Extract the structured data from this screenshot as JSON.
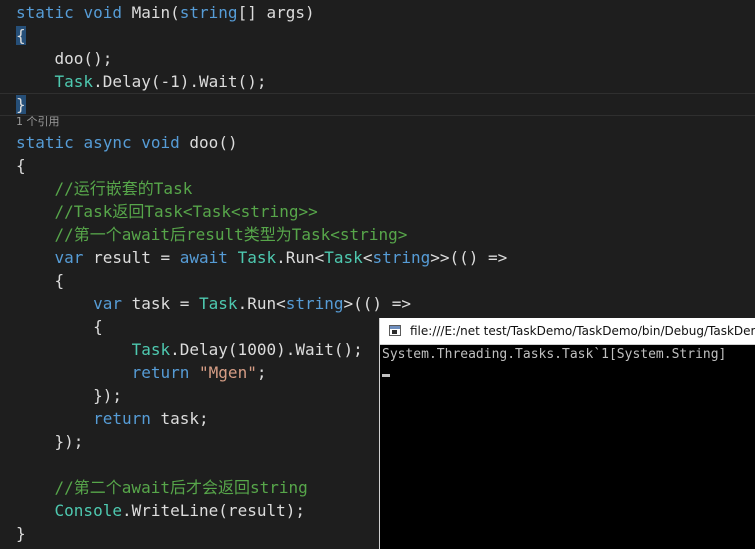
{
  "colors": {
    "editor_bg": "#1e1e1e",
    "keyword": "#569cd6",
    "type": "#4ec9b0",
    "comment": "#57a64a",
    "string": "#d69d85",
    "text": "#dcdcdc",
    "console_bg": "#000000"
  },
  "editor": {
    "codelens": "1 个引用",
    "lines": [
      [
        {
          "c": "kw",
          "t": "static"
        },
        {
          "c": "tx",
          "t": " "
        },
        {
          "c": "kw",
          "t": "void"
        },
        {
          "c": "tx",
          "t": " Main("
        },
        {
          "c": "kw",
          "t": "string"
        },
        {
          "c": "tx",
          "t": "[] args)"
        }
      ],
      [
        {
          "c": "tx br-hl",
          "t": "{"
        }
      ],
      [
        {
          "c": "tx",
          "t": "    doo();"
        }
      ],
      [
        {
          "c": "tx",
          "t": "    "
        },
        {
          "c": "ty",
          "t": "Task"
        },
        {
          "c": "tx",
          "t": ".Delay(-1).Wait();"
        }
      ],
      [
        {
          "c": "tx br-hl",
          "t": "}"
        }
      ],
      [
        {
          "c": "kw",
          "t": "static"
        },
        {
          "c": "tx",
          "t": " "
        },
        {
          "c": "kw",
          "t": "async"
        },
        {
          "c": "tx",
          "t": " "
        },
        {
          "c": "kw",
          "t": "void"
        },
        {
          "c": "tx",
          "t": " doo()"
        }
      ],
      [
        {
          "c": "tx",
          "t": "{"
        }
      ],
      [
        {
          "c": "tx",
          "t": "    "
        },
        {
          "c": "cm",
          "t": "//运行嵌套的Task"
        }
      ],
      [
        {
          "c": "tx",
          "t": "    "
        },
        {
          "c": "cm",
          "t": "//Task返回Task<Task<string>>"
        }
      ],
      [
        {
          "c": "tx",
          "t": "    "
        },
        {
          "c": "cm",
          "t": "//第一个await后result类型为Task<string>"
        }
      ],
      [
        {
          "c": "tx",
          "t": "    "
        },
        {
          "c": "kw",
          "t": "var"
        },
        {
          "c": "tx",
          "t": " result = "
        },
        {
          "c": "kw",
          "t": "await"
        },
        {
          "c": "tx",
          "t": " "
        },
        {
          "c": "ty",
          "t": "Task"
        },
        {
          "c": "tx",
          "t": ".Run<"
        },
        {
          "c": "ty",
          "t": "Task"
        },
        {
          "c": "tx",
          "t": "<"
        },
        {
          "c": "kw",
          "t": "string"
        },
        {
          "c": "tx",
          "t": ">>(() =>"
        }
      ],
      [
        {
          "c": "tx",
          "t": "    {"
        }
      ],
      [
        {
          "c": "tx",
          "t": "        "
        },
        {
          "c": "kw",
          "t": "var"
        },
        {
          "c": "tx",
          "t": " task = "
        },
        {
          "c": "ty",
          "t": "Task"
        },
        {
          "c": "tx",
          "t": ".Run<"
        },
        {
          "c": "kw",
          "t": "string"
        },
        {
          "c": "tx",
          "t": ">(() =>"
        }
      ],
      [
        {
          "c": "tx",
          "t": "        {"
        }
      ],
      [
        {
          "c": "tx",
          "t": "            "
        },
        {
          "c": "ty",
          "t": "Task"
        },
        {
          "c": "tx",
          "t": ".Delay(1000).Wait();"
        }
      ],
      [
        {
          "c": "tx",
          "t": "            "
        },
        {
          "c": "kw",
          "t": "return"
        },
        {
          "c": "tx",
          "t": " "
        },
        {
          "c": "st",
          "t": "\"Mgen\""
        },
        {
          "c": "tx",
          "t": ";"
        }
      ],
      [
        {
          "c": "tx",
          "t": "        });"
        }
      ],
      [
        {
          "c": "tx",
          "t": "        "
        },
        {
          "c": "kw",
          "t": "return"
        },
        {
          "c": "tx",
          "t": " task;"
        }
      ],
      [
        {
          "c": "tx",
          "t": "    });"
        }
      ],
      [
        {
          "c": "tx",
          "t": ""
        }
      ],
      [
        {
          "c": "tx",
          "t": "    "
        },
        {
          "c": "cm",
          "t": "//第二个await后才会返回string"
        }
      ],
      [
        {
          "c": "tx",
          "t": "    "
        },
        {
          "c": "ty",
          "t": "Console"
        },
        {
          "c": "tx",
          "t": ".WriteLine(result);"
        }
      ],
      [
        {
          "c": "tx",
          "t": "}"
        }
      ]
    ]
  },
  "console": {
    "title": "file:///E:/net test/TaskDemo/TaskDemo/bin/Debug/TaskDemo.EXE",
    "output": "System.Threading.Tasks.Task`1[System.String]"
  }
}
